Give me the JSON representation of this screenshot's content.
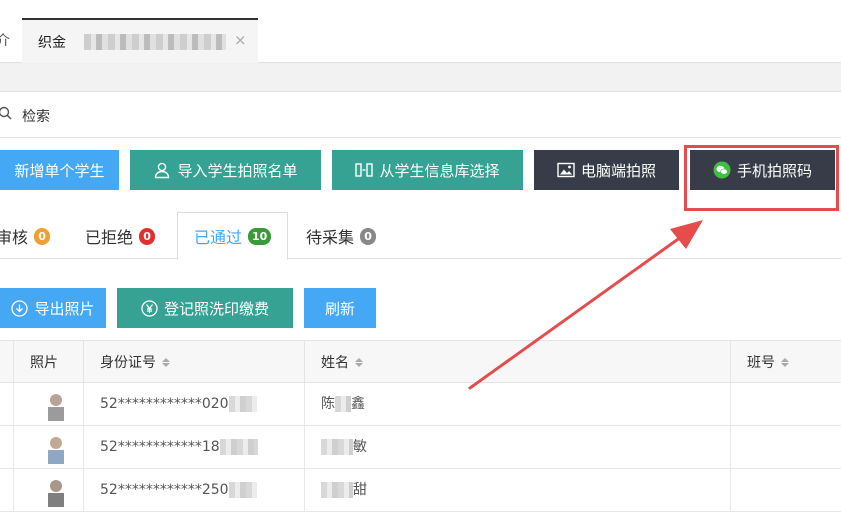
{
  "tabs": {
    "prev_label": "介",
    "active_label": "织金",
    "close_glyph": "×"
  },
  "search": {
    "label": "检索"
  },
  "toolbar": {
    "add_single_student": "新增单个学生",
    "import_photo_list": "导入学生拍照名单",
    "select_from_library": "从学生信息库选择",
    "pc_photo": "电脑端拍照",
    "mobile_qr": "手机拍照码"
  },
  "status_tabs": [
    {
      "label": "审核",
      "count": "0",
      "color": "#f0a030"
    },
    {
      "label": "已拒绝",
      "count": "0",
      "color": "#e03030"
    },
    {
      "label": "已通过",
      "count": "10",
      "color": "#3a9a3a"
    },
    {
      "label": "待采集",
      "count": "0",
      "color": "#888888"
    }
  ],
  "actions": {
    "export_photos": "导出照片",
    "register_print_fee": "登记照洗印缴费",
    "refresh": "刷新"
  },
  "table": {
    "columns": [
      "照片",
      "身份证号",
      "姓名",
      "班号"
    ],
    "rows": [
      {
        "id": "52************020",
        "name_visible": "陈",
        "name_tail": "鑫"
      },
      {
        "id": "52************18",
        "name_visible": "",
        "name_tail": "敏"
      },
      {
        "id": "52************250",
        "name_visible": "",
        "name_tail": "甜"
      }
    ]
  },
  "colors": {
    "blue": "#45a8f5",
    "teal": "#35a293",
    "dark": "#373c48",
    "highlight": "#e74c4c"
  }
}
